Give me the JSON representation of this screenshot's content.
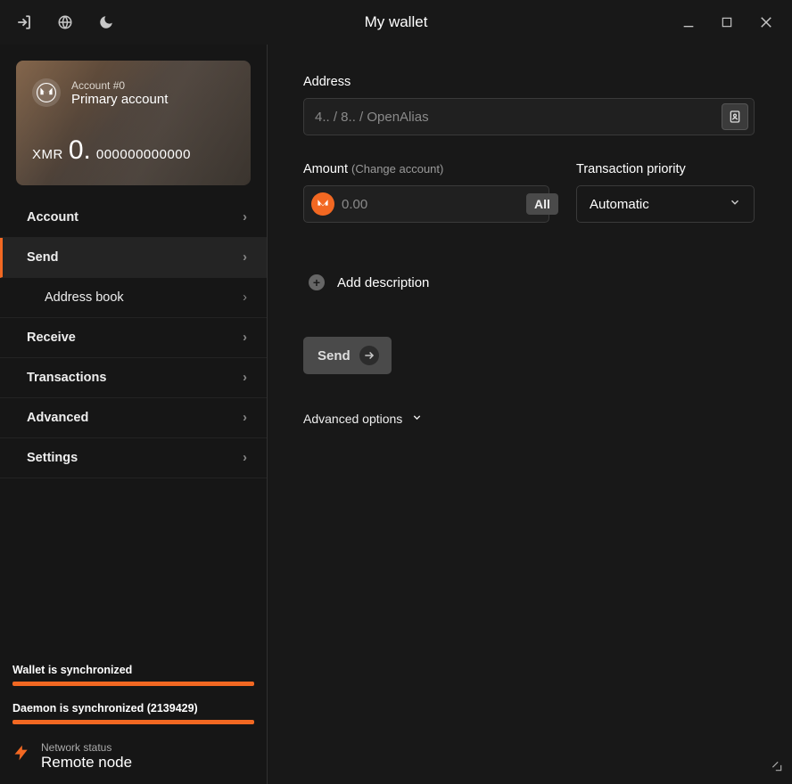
{
  "titlebar": {
    "title": "My wallet"
  },
  "account": {
    "id_label": "Account #0",
    "name": "Primary account",
    "currency": "XMR",
    "balance_int": "0.",
    "balance_dec": "000000000000"
  },
  "nav": {
    "account": "Account",
    "send": "Send",
    "address_book": "Address book",
    "receive": "Receive",
    "transactions": "Transactions",
    "advanced": "Advanced",
    "settings": "Settings"
  },
  "sync": {
    "wallet_label": "Wallet is synchronized",
    "daemon_label": "Daemon is synchronized (2139429)"
  },
  "network": {
    "title": "Network status",
    "status": "Remote node"
  },
  "send": {
    "address_label": "Address",
    "address_placeholder": "4.. / 8.. / OpenAlias",
    "amount_label": "Amount",
    "change_account": "(Change account)",
    "amount_placeholder": "0.00",
    "all_label": "All",
    "priority_label": "Transaction priority",
    "priority_value": "Automatic",
    "add_description": "Add description",
    "send_button": "Send",
    "advanced_options": "Advanced options"
  }
}
